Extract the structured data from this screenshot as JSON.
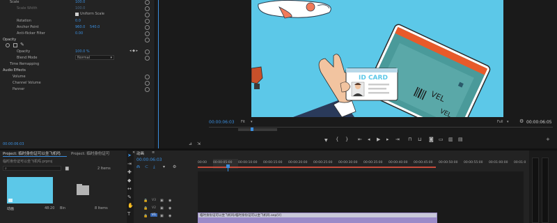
{
  "effect_controls": {
    "rows": [
      {
        "label": "Scale",
        "value": "100.0"
      },
      {
        "label": "Scale Width",
        "value": "100.0"
      },
      {
        "label": "Uniform Scale",
        "value": ""
      },
      {
        "label": "Rotation",
        "value": "0.0"
      },
      {
        "label": "Anchor Point",
        "value": "960.0",
        "value2": "540.0"
      },
      {
        "label": "Anti-flicker Filter",
        "value": "0.00"
      },
      {
        "label": "Opacity",
        "value": ""
      },
      {
        "label": "Opacity",
        "value": "100.0 %"
      },
      {
        "label": "Blend Mode",
        "value": "Normal"
      },
      {
        "label": "Time Remapping",
        "value": ""
      },
      {
        "label": "Audio Effects",
        "value": ""
      },
      {
        "label": "Volume",
        "value": ""
      },
      {
        "label": "Channel Volume",
        "value": ""
      },
      {
        "label": "Panner",
        "value": ""
      }
    ],
    "timecode": "00:00:06:03"
  },
  "program_monitor": {
    "timecode": "00:00:06:03",
    "fit": "Fit",
    "quality": "Full",
    "duration": "00:00:06:05",
    "id_card_text": "ID CARD",
    "ticket_text_1": "VEL",
    "ticket_text_2": "VEL"
  },
  "project_panel": {
    "tab_project": "Project: 临时身份证可以坐飞机吗",
    "tab_project2": "Project: 临时身份证可",
    "project_file": "临时身份证可以坐飞机吗.prproj",
    "items_count": "2 Items",
    "item1_name": "动画",
    "item1_duration": "48:20",
    "item2_name": "Bin",
    "item2_count": "8 Items"
  },
  "timeline": {
    "tab": "动画",
    "timecode": "00:00:06:03",
    "ruler": [
      "00:00",
      "00:00:05:00",
      "00:00:10:00",
      "00:00:15:00",
      "00:00:20:00",
      "00:00:25:00",
      "00:00:30:00",
      "00:00:35:00",
      "00:00:40:00",
      "00:00:45:00",
      "00:00:50:00",
      "00:00:55:00",
      "00:01:00:00",
      "00:01:0"
    ],
    "tracks": [
      "V3",
      "V2",
      "V1"
    ],
    "clip_label": "临时身份证可以坐飞机吗/临时身份证可以坐飞机吗.aep[V]"
  },
  "colors": {
    "accent": "#3a8fe0",
    "scene_bg": "#5cc8e8",
    "ticket_teal": "#4a9a9a",
    "ticket_orange": "#e85a2a",
    "clip_purple": "#9a8ac8"
  }
}
